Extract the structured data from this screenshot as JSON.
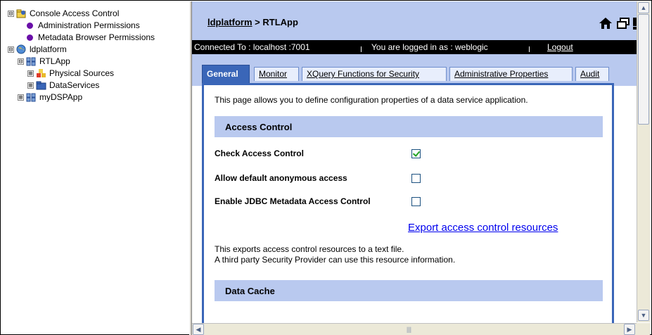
{
  "tree": {
    "items": [
      {
        "label": "Console Access Control",
        "expander": "⊟"
      },
      {
        "label": "Administration Permissions"
      },
      {
        "label": "Metadata Browser Permissions"
      },
      {
        "label": "ldplatform",
        "expander": "⊟"
      },
      {
        "label": "RTLApp",
        "expander": "⊟"
      },
      {
        "label": "Physical Sources",
        "expander": "⊞"
      },
      {
        "label": "DataServices",
        "expander": "⊞"
      },
      {
        "label": "myDSPApp",
        "expander": "⊞"
      }
    ]
  },
  "header": {
    "breadcrumb_link": "ldplatform",
    "breadcrumb_rest": " > RTLApp"
  },
  "status": {
    "connected": "Connected To :  localhost :7001",
    "logged_in": "You are logged in as :  weblogic",
    "logout": "Logout"
  },
  "tabs": [
    {
      "label": "General",
      "active": true
    },
    {
      "label": "Monitor"
    },
    {
      "label": "XQuery Functions for Security"
    },
    {
      "label": "Administrative Properties"
    },
    {
      "label": "Audit"
    }
  ],
  "page": {
    "intro": "This page allows you to define configuration properties of a data service application.",
    "access_section": "Access Control",
    "check_access_label": "Check Access Control",
    "check_access_value": true,
    "anon_label": "Allow default anonymous access",
    "anon_value": false,
    "jdbc_label": "Enable JDBC Metadata Access Control",
    "jdbc_value": false,
    "export_link": "Export access control resources",
    "note1": "This exports access control resources to a text file.",
    "note2": "A third party Security Provider can use this resource information.",
    "cache_section": "Data Cache"
  },
  "colors": {
    "header_bg": "#b9c9ef",
    "tab_active": "#3a66b8",
    "bullet": "#6a0fa8"
  }
}
